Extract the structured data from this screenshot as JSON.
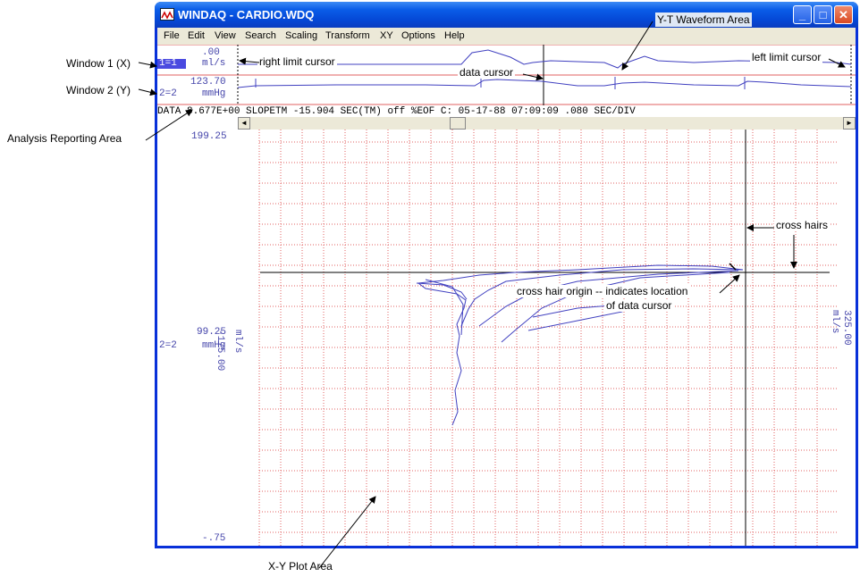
{
  "window": {
    "title": "WINDAQ - CARDIO.WDQ",
    "controls": {
      "minimize": "_",
      "maximize": "□",
      "close": "✕"
    }
  },
  "menu": [
    "File",
    "Edit",
    "View",
    "Search",
    "Scaling",
    "Transform",
    "XY",
    "Options",
    "Help"
  ],
  "channels": [
    {
      "value": ".00",
      "unit": "ml/s",
      "tag": "1=1"
    },
    {
      "value": "123.70",
      "unit": "mmHg",
      "tag": "2=2"
    }
  ],
  "status_line": "DATA  8.677E+00 SLOPETM    -15.904 SEC(TM)   off %EOF C: 05-17-88 07:09:09 .080 SEC/DIV",
  "xy_plot": {
    "y_top": "199.25",
    "y_mid": "99.25",
    "y_bottom": "-.75",
    "y_channel": "2=2",
    "y_unit": "mmHg",
    "x_left": "-175.00",
    "x_right": "325.00",
    "x_unit": "ml/s"
  },
  "annotations": {
    "window1": "Window 1 (X)",
    "window2": "Window 2 (Y)",
    "analysis": "Analysis Reporting Area",
    "right_limit": "right limit cursor",
    "data_cursor": "data cursor",
    "yt_area": "Y-T Waveform Area",
    "left_limit": "left limit cursor",
    "cross_hairs": "cross hairs",
    "origin_line1": "cross hair origin -- indicates location",
    "origin_line2": "of data cursor",
    "xy_area": "X-Y Plot Area"
  },
  "colors": {
    "trace": "#4040c0",
    "grid": "#e06060",
    "titlebar": "#0a5de8",
    "label": "#4444aa"
  }
}
